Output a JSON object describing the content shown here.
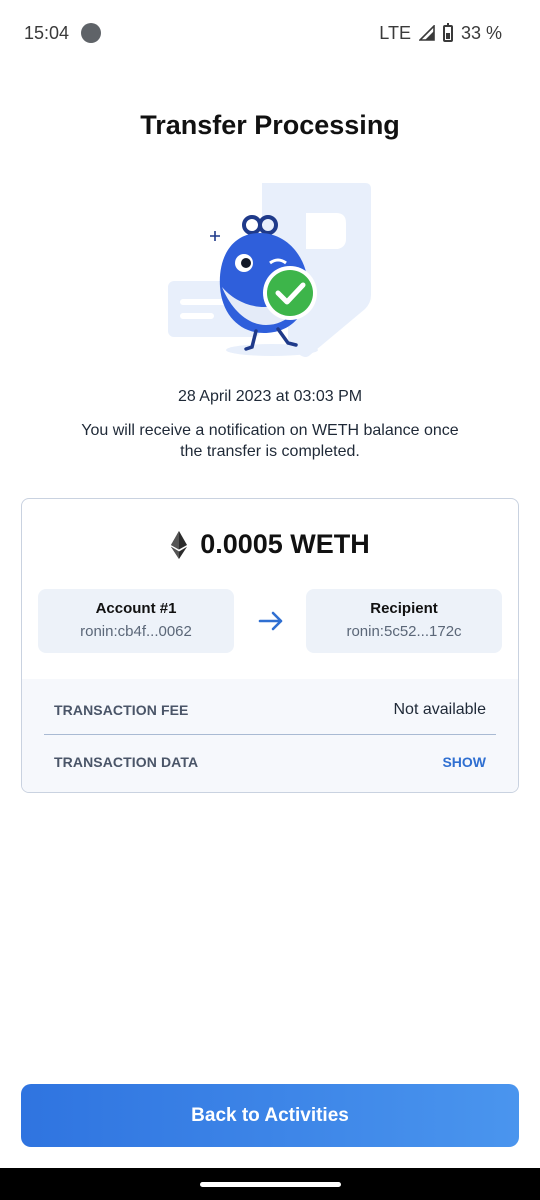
{
  "status_bar": {
    "time": "15:04",
    "network": "LTE",
    "battery": "33 %"
  },
  "page": {
    "title": "Transfer Processing",
    "date": "28 April 2023 at 03:03 PM",
    "notice": "You will receive a notification on WETH balance once the transfer is completed."
  },
  "transfer": {
    "token_icon": "ethereum-icon",
    "amount": "0.0005 WETH",
    "from": {
      "name": "Account #1",
      "address": "ronin:cb4f...0062"
    },
    "to": {
      "name": "Recipient",
      "address": "ronin:5c52...172c"
    },
    "arrow_icon": "arrow-right-icon"
  },
  "details": {
    "fee_label": "TRANSACTION FEE",
    "fee_value": "Not available",
    "data_label": "TRANSACTION DATA",
    "data_action": "SHOW"
  },
  "actions": {
    "back_label": "Back to Activities"
  },
  "colors": {
    "accent": "#2f6fd1",
    "button_start": "#2f74e0",
    "button_end": "#4a95ee",
    "check_green": "#3db54a"
  }
}
